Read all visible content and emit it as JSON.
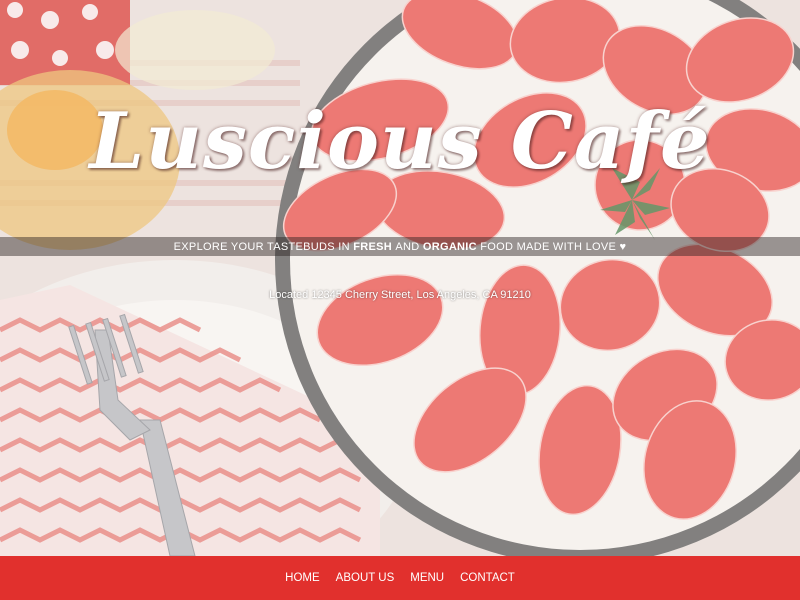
{
  "hero": {
    "brand_name": "Luscious Café",
    "tagline": {
      "part1": "EXPLORE YOUR TASTEBUDS IN ",
      "bold1": "FRESH",
      "part2": " AND ",
      "bold2": "ORGANIC",
      "part3": " FOOD MADE WITH LOVE ",
      "heart": "♥"
    },
    "location": "Located 12345 Cherry Street, Los Angeles, CA 91210"
  },
  "nav": {
    "items": [
      {
        "label": "HOME"
      },
      {
        "label": "ABOUT US"
      },
      {
        "label": "MENU"
      },
      {
        "label": "CONTACT"
      }
    ]
  },
  "colors": {
    "nav_bg": "#e1302d",
    "strawberry": "#e8544e",
    "cream": "#f5efe8"
  }
}
